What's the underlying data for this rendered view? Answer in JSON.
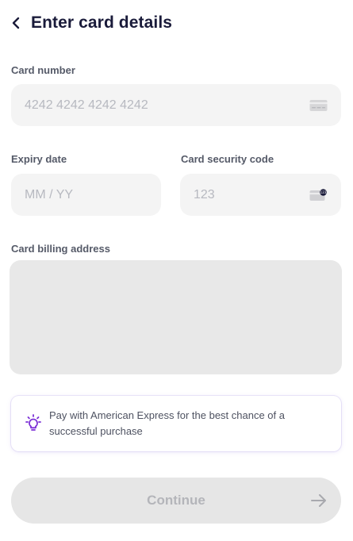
{
  "header": {
    "title": "Enter card details",
    "back_icon": "chevron-left-icon"
  },
  "card_number": {
    "label": "Card number",
    "placeholder": "4242 4242 4242 4242",
    "value": "",
    "icon": "credit-card-icon"
  },
  "expiry": {
    "label": "Expiry date",
    "placeholder": "MM / YY",
    "value": ""
  },
  "security_code": {
    "label": "Card security code",
    "placeholder": "123",
    "value": "",
    "icon": "card-cvc-icon"
  },
  "billing": {
    "label": "Card billing address"
  },
  "tip": {
    "icon": "lightbulb-icon",
    "text": "Pay with American Express for the best chance of a successful purchase",
    "icon_color": "#7b2fd6"
  },
  "continue_button": {
    "label": "Continue",
    "icon": "arrow-right-icon",
    "disabled": true
  },
  "colors": {
    "text_primary": "#1a1b3a",
    "label": "#555a68",
    "field_bg": "#f4f4f4",
    "placeholder": "#b7b9c0",
    "disabled_button_bg": "#e6e6e6",
    "accent": "#7b2fd6"
  }
}
